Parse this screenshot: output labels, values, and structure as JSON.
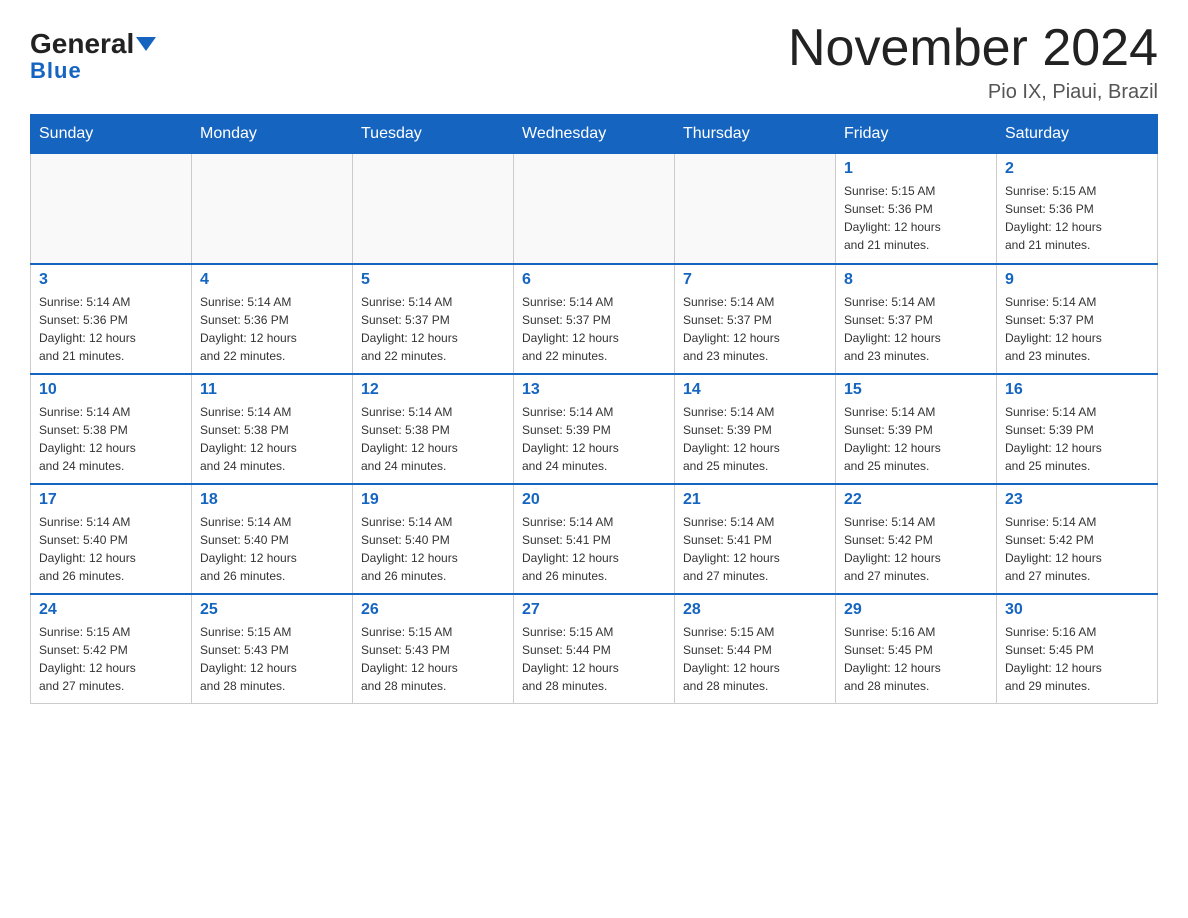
{
  "header": {
    "logo_general": "General",
    "logo_blue": "Blue",
    "month_title": "November 2024",
    "location": "Pio IX, Piaui, Brazil"
  },
  "days_of_week": [
    "Sunday",
    "Monday",
    "Tuesday",
    "Wednesday",
    "Thursday",
    "Friday",
    "Saturday"
  ],
  "weeks": [
    [
      {
        "day": "",
        "info": ""
      },
      {
        "day": "",
        "info": ""
      },
      {
        "day": "",
        "info": ""
      },
      {
        "day": "",
        "info": ""
      },
      {
        "day": "",
        "info": ""
      },
      {
        "day": "1",
        "info": "Sunrise: 5:15 AM\nSunset: 5:36 PM\nDaylight: 12 hours\nand 21 minutes."
      },
      {
        "day": "2",
        "info": "Sunrise: 5:15 AM\nSunset: 5:36 PM\nDaylight: 12 hours\nand 21 minutes."
      }
    ],
    [
      {
        "day": "3",
        "info": "Sunrise: 5:14 AM\nSunset: 5:36 PM\nDaylight: 12 hours\nand 21 minutes."
      },
      {
        "day": "4",
        "info": "Sunrise: 5:14 AM\nSunset: 5:36 PM\nDaylight: 12 hours\nand 22 minutes."
      },
      {
        "day": "5",
        "info": "Sunrise: 5:14 AM\nSunset: 5:37 PM\nDaylight: 12 hours\nand 22 minutes."
      },
      {
        "day": "6",
        "info": "Sunrise: 5:14 AM\nSunset: 5:37 PM\nDaylight: 12 hours\nand 22 minutes."
      },
      {
        "day": "7",
        "info": "Sunrise: 5:14 AM\nSunset: 5:37 PM\nDaylight: 12 hours\nand 23 minutes."
      },
      {
        "day": "8",
        "info": "Sunrise: 5:14 AM\nSunset: 5:37 PM\nDaylight: 12 hours\nand 23 minutes."
      },
      {
        "day": "9",
        "info": "Sunrise: 5:14 AM\nSunset: 5:37 PM\nDaylight: 12 hours\nand 23 minutes."
      }
    ],
    [
      {
        "day": "10",
        "info": "Sunrise: 5:14 AM\nSunset: 5:38 PM\nDaylight: 12 hours\nand 24 minutes."
      },
      {
        "day": "11",
        "info": "Sunrise: 5:14 AM\nSunset: 5:38 PM\nDaylight: 12 hours\nand 24 minutes."
      },
      {
        "day": "12",
        "info": "Sunrise: 5:14 AM\nSunset: 5:38 PM\nDaylight: 12 hours\nand 24 minutes."
      },
      {
        "day": "13",
        "info": "Sunrise: 5:14 AM\nSunset: 5:39 PM\nDaylight: 12 hours\nand 24 minutes."
      },
      {
        "day": "14",
        "info": "Sunrise: 5:14 AM\nSunset: 5:39 PM\nDaylight: 12 hours\nand 25 minutes."
      },
      {
        "day": "15",
        "info": "Sunrise: 5:14 AM\nSunset: 5:39 PM\nDaylight: 12 hours\nand 25 minutes."
      },
      {
        "day": "16",
        "info": "Sunrise: 5:14 AM\nSunset: 5:39 PM\nDaylight: 12 hours\nand 25 minutes."
      }
    ],
    [
      {
        "day": "17",
        "info": "Sunrise: 5:14 AM\nSunset: 5:40 PM\nDaylight: 12 hours\nand 26 minutes."
      },
      {
        "day": "18",
        "info": "Sunrise: 5:14 AM\nSunset: 5:40 PM\nDaylight: 12 hours\nand 26 minutes."
      },
      {
        "day": "19",
        "info": "Sunrise: 5:14 AM\nSunset: 5:40 PM\nDaylight: 12 hours\nand 26 minutes."
      },
      {
        "day": "20",
        "info": "Sunrise: 5:14 AM\nSunset: 5:41 PM\nDaylight: 12 hours\nand 26 minutes."
      },
      {
        "day": "21",
        "info": "Sunrise: 5:14 AM\nSunset: 5:41 PM\nDaylight: 12 hours\nand 27 minutes."
      },
      {
        "day": "22",
        "info": "Sunrise: 5:14 AM\nSunset: 5:42 PM\nDaylight: 12 hours\nand 27 minutes."
      },
      {
        "day": "23",
        "info": "Sunrise: 5:14 AM\nSunset: 5:42 PM\nDaylight: 12 hours\nand 27 minutes."
      }
    ],
    [
      {
        "day": "24",
        "info": "Sunrise: 5:15 AM\nSunset: 5:42 PM\nDaylight: 12 hours\nand 27 minutes."
      },
      {
        "day": "25",
        "info": "Sunrise: 5:15 AM\nSunset: 5:43 PM\nDaylight: 12 hours\nand 28 minutes."
      },
      {
        "day": "26",
        "info": "Sunrise: 5:15 AM\nSunset: 5:43 PM\nDaylight: 12 hours\nand 28 minutes."
      },
      {
        "day": "27",
        "info": "Sunrise: 5:15 AM\nSunset: 5:44 PM\nDaylight: 12 hours\nand 28 minutes."
      },
      {
        "day": "28",
        "info": "Sunrise: 5:15 AM\nSunset: 5:44 PM\nDaylight: 12 hours\nand 28 minutes."
      },
      {
        "day": "29",
        "info": "Sunrise: 5:16 AM\nSunset: 5:45 PM\nDaylight: 12 hours\nand 28 minutes."
      },
      {
        "day": "30",
        "info": "Sunrise: 5:16 AM\nSunset: 5:45 PM\nDaylight: 12 hours\nand 29 minutes."
      }
    ]
  ]
}
